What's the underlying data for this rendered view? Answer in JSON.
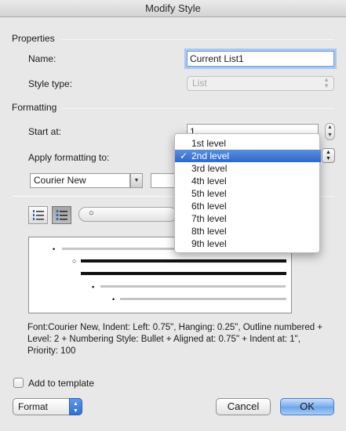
{
  "window": {
    "title": "Modify Style"
  },
  "properties": {
    "section_label": "Properties",
    "name_label": "Name:",
    "name_value": "Current List1",
    "style_type_label": "Style type:",
    "style_type_value": "List"
  },
  "formatting": {
    "section_label": "Formatting",
    "start_at_label": "Start at:",
    "start_at_value": "1",
    "apply_label": "Apply formatting to:",
    "font_value": "Courier New",
    "bullet_symbol": "○"
  },
  "apply_menu": {
    "selected_index": 1,
    "check_glyph": "✓",
    "items": [
      "1st level",
      "2nd level",
      "3rd level",
      "4th level",
      "5th level",
      "6th level",
      "7th level",
      "8th level",
      "9th level"
    ]
  },
  "preview": {
    "bullets": [
      "•",
      "○",
      "▪",
      "•"
    ]
  },
  "description": "Font:Courier New, Indent: Left: 0.75\", Hanging: 0.25\", Outline numbered + Level: 2 + Numbering Style: Bullet + Aligned at: 0.75\" + Indent at: 1\", Priority: 100",
  "footer": {
    "add_template_label": "Add to template",
    "format_label": "Format",
    "cancel_label": "Cancel",
    "ok_label": "OK"
  },
  "colors": {
    "accent": "#3a72d6",
    "default_button": "#78aeee",
    "focus_ring": "#a9c7f0"
  },
  "icons": [
    "numbered-list-icon",
    "bulleted-list-icon",
    "checkmark-icon",
    "up-down-arrows-icon"
  ]
}
